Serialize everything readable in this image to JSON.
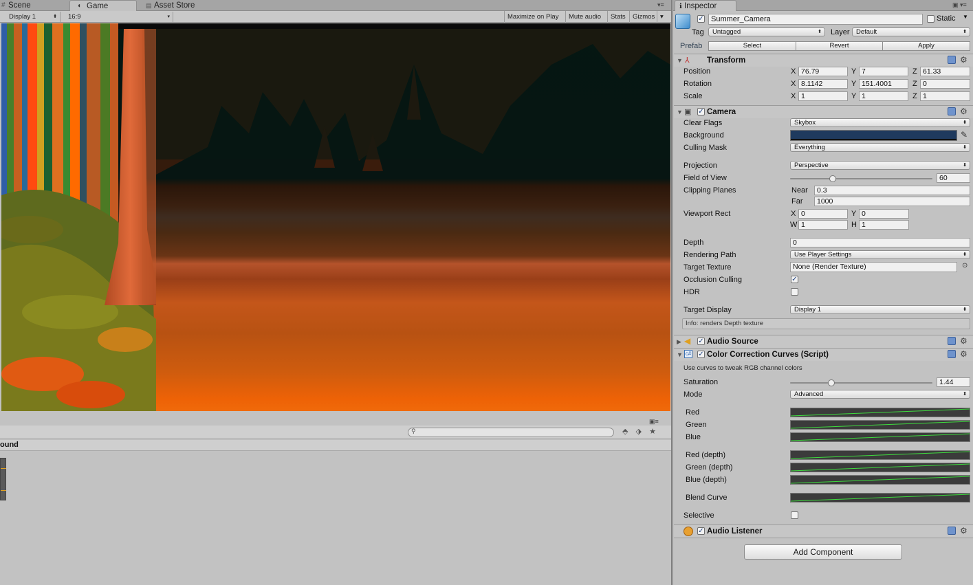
{
  "tabs": {
    "scene": "Scene",
    "game": "Game",
    "asset_store": "Asset Store",
    "inspector": "Inspector"
  },
  "game_toolbar": {
    "display": "Display 1",
    "aspect": "16:9",
    "maximize": "Maximize on Play",
    "mute": "Mute audio",
    "stats": "Stats",
    "gizmos": "Gizmos"
  },
  "lower_panel": {
    "title": "ound"
  },
  "inspector": {
    "object_name": "Summer_Camera",
    "static_label": "Static",
    "tag_label": "Tag",
    "tag_value": "Untagged",
    "layer_label": "Layer",
    "layer_value": "Default",
    "prefab_label": "Prefab",
    "prefab_select": "Select",
    "prefab_revert": "Revert",
    "prefab_apply": "Apply",
    "transform": {
      "title": "Transform",
      "position_label": "Position",
      "pos_x": "76.79",
      "pos_y": "7",
      "pos_z": "61.33",
      "rotation_label": "Rotation",
      "rot_x": "8.1142",
      "rot_y": "151.4001",
      "rot_z": "0",
      "scale_label": "Scale",
      "sc_x": "1",
      "sc_y": "1",
      "sc_z": "1"
    },
    "axes": {
      "x": "X",
      "y": "Y",
      "z": "Z",
      "w": "W",
      "h": "H"
    },
    "camera": {
      "title": "Camera",
      "clear_flags_label": "Clear Flags",
      "clear_flags": "Skybox",
      "background_label": "Background",
      "background_color": "#1f3a5e",
      "culling_label": "Culling Mask",
      "culling": "Everything",
      "projection_label": "Projection",
      "projection": "Perspective",
      "fov_label": "Field of View",
      "fov": "60",
      "fov_fraction": 0.3,
      "clipping_label": "Clipping Planes",
      "near_label": "Near",
      "near": "0.3",
      "far_label": "Far",
      "far": "1000",
      "viewport_label": "Viewport Rect",
      "vp_x": "0",
      "vp_y": "0",
      "vp_w": "1",
      "vp_h": "1",
      "depth_label": "Depth",
      "depth": "0",
      "rendering_label": "Rendering Path",
      "rendering": "Use Player Settings",
      "target_texture_label": "Target Texture",
      "target_texture": "None (Render Texture)",
      "occlusion_label": "Occlusion Culling",
      "occlusion": true,
      "hdr_label": "HDR",
      "hdr": false,
      "target_display_label": "Target Display",
      "target_display": "Display 1",
      "info": "Info: renders Depth texture"
    },
    "audio_source": {
      "title": "Audio Source"
    },
    "ccc": {
      "title": "Color Correction Curves (Script)",
      "desc": "Use curves to tweak RGB channel colors",
      "saturation_label": "Saturation",
      "saturation": "1.44",
      "saturation_fraction": 0.29,
      "mode_label": "Mode",
      "mode": "Advanced",
      "red": "Red",
      "green": "Green",
      "blue": "Blue",
      "red_depth": "Red (depth)",
      "green_depth": "Green (depth)",
      "blue_depth": "Blue (depth)",
      "blend": "Blend Curve",
      "selective_label": "Selective",
      "selective": false
    },
    "audio_listener": {
      "title": "Audio Listener"
    },
    "add_component": "Add Component"
  }
}
